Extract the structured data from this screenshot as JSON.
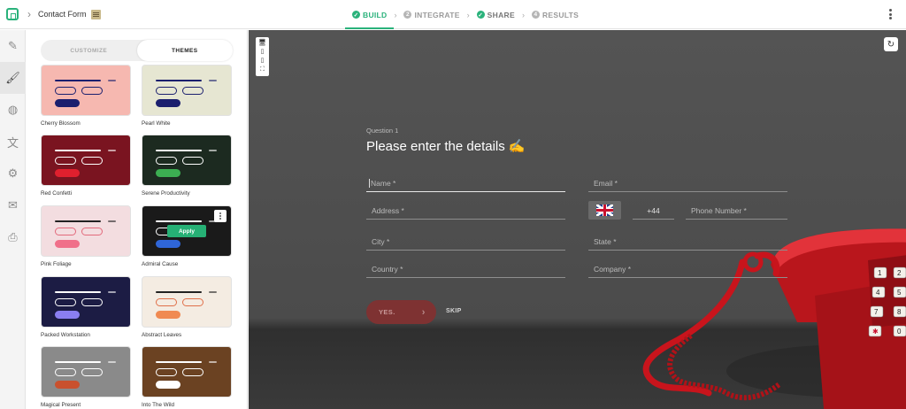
{
  "header": {
    "form_title": "Contact Form",
    "steps": [
      {
        "label": "BUILD",
        "num": "✓"
      },
      {
        "label": "INTEGRATE",
        "num": "2"
      },
      {
        "label": "SHARE",
        "num": "✓"
      },
      {
        "label": "RESULTS",
        "num": "4"
      }
    ]
  },
  "panel": {
    "tabs": [
      "CUSTOMIZE",
      "THEMES"
    ],
    "apply_label": "Apply",
    "themes": [
      {
        "name": "Cherry Blossom",
        "bg": "#f6b8b0",
        "line": "#1b1f6e",
        "field": "#1b1f6e",
        "btn": "#1b1f6e"
      },
      {
        "name": "Pearl White",
        "bg": "#e6e6d2",
        "line": "#1b1f6e",
        "field": "#1b1f6e",
        "btn": "#1b1f6e"
      },
      {
        "name": "Red Confetti",
        "bg": "#7a1420",
        "line": "#ffffff",
        "field": "#ffffff",
        "btn": "#e0202e"
      },
      {
        "name": "Serene Productivity",
        "bg": "#1c2a20",
        "line": "#ffffff",
        "field": "#ffffff",
        "btn": "#3cae52"
      },
      {
        "name": "Pink Foliage",
        "bg": "#f3dde0",
        "line": "#222222",
        "field": "#e26a7c",
        "btn": "#f0708a"
      },
      {
        "name": "Admiral Cause",
        "bg": "#1a1a1a",
        "line": "#ffffff",
        "field": "#ffffff",
        "btn": "#2f66d8"
      },
      {
        "name": "Packed Workstation",
        "bg": "#1c1c44",
        "line": "#ffffff",
        "field": "#ffffff",
        "btn": "#8a7ef0"
      },
      {
        "name": "Abstract Leaves",
        "bg": "#f4ece2",
        "line": "#222222",
        "field": "#e0704a",
        "btn": "#f08a52"
      },
      {
        "name": "Magical Present",
        "bg": "#8a8a8a",
        "line": "#ffffff",
        "field": "#ffffff",
        "btn": "#c9512e"
      },
      {
        "name": "Into The Wild",
        "bg": "#6b4222",
        "line": "#ffffff",
        "field": "#ffffff",
        "btn": "#ffffff"
      }
    ]
  },
  "stage": {
    "question_number": "Question 1",
    "question_title": "Please enter the details ✍️",
    "fields": {
      "name": "Name *",
      "email": "Email *",
      "address": "Address *",
      "country_code": "+44",
      "phone": "Phone Number *",
      "city": "City *",
      "state": "State *",
      "country": "Country *",
      "company": "Company *"
    },
    "yes_label": "YES.",
    "skip_label": "SKIP",
    "accent": "#2ab27b"
  }
}
